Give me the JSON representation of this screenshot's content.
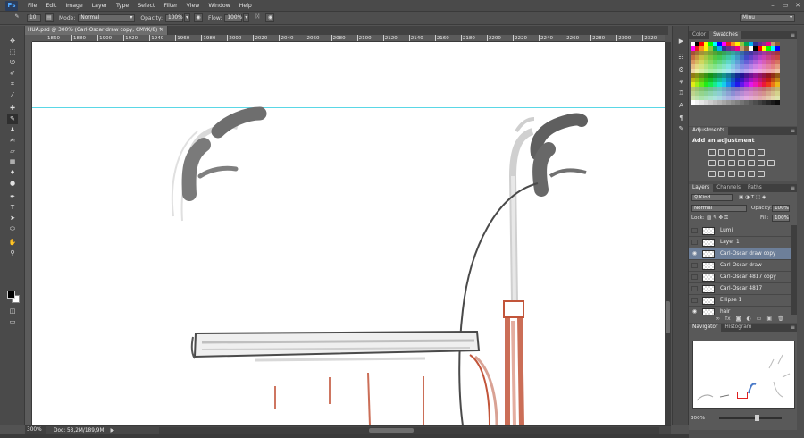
{
  "menubar": {
    "logo": "Ps",
    "items": [
      "File",
      "Edit",
      "Image",
      "Layer",
      "Type",
      "Select",
      "Filter",
      "View",
      "Window",
      "Help"
    ],
    "window_controls": [
      "–",
      "▭",
      "✕"
    ]
  },
  "options": {
    "brush_size": "10",
    "mode_label": "Mode:",
    "mode_value": "Normal",
    "opacity_label": "Opacity:",
    "opacity_value": "100%",
    "flow_label": "Flow:",
    "flow_value": "100%",
    "workspace": "Minu"
  },
  "document": {
    "tab_title": "HUA.psd @ 300% (Carl-Oscar draw copy, CMYK/8) *",
    "tab_close": "×"
  },
  "ruler": {
    "labels": [
      "1860",
      "1880",
      "1900",
      "1920",
      "1940",
      "1960",
      "1980",
      "2000",
      "2020",
      "2040",
      "2060",
      "2080",
      "2100",
      "2120",
      "2140",
      "2160",
      "2180",
      "2200",
      "2220",
      "2240",
      "2260",
      "2280",
      "2300",
      "2320",
      "2340"
    ]
  },
  "status": {
    "zoom": "300%",
    "doc_size": "Doc: 53,2M/189,9M",
    "arrow": "▶"
  },
  "panels": {
    "color_tab": "Color",
    "swatches_tab": "Swatches",
    "adjustments_tab": "Adjustments",
    "adjustments_title": "Add an adjustment",
    "layers_tab": "Layers",
    "channels_tab": "Channels",
    "paths_tab": "Paths",
    "kind_label": "Kind",
    "blend_mode": "Normal",
    "opacity_label": "Opacity:",
    "opacity_value": "100%",
    "lock_label": "Lock:",
    "fill_label": "Fill:",
    "fill_value": "100%",
    "layers": [
      {
        "name": "Lumi",
        "visible": false,
        "selected": false
      },
      {
        "name": "Layer 1",
        "visible": false,
        "selected": false
      },
      {
        "name": "Carl-Oscar draw copy",
        "visible": true,
        "selected": true
      },
      {
        "name": "Carl-Oscar draw",
        "visible": false,
        "selected": false
      },
      {
        "name": "Carl-Oscar 4817 copy",
        "visible": false,
        "selected": false
      },
      {
        "name": "Carl-Oscar 4817",
        "visible": false,
        "selected": false
      },
      {
        "name": "Ellipse 1",
        "visible": false,
        "selected": false
      },
      {
        "name": "hair",
        "visible": true,
        "selected": false
      }
    ],
    "navigator_tab": "Navigator",
    "histogram_tab": "Histogram",
    "navigator_zoom": "300%"
  },
  "colors": {
    "accent_selection": "#6d7f99",
    "guide": "#5ad7e6",
    "brush_red": "#c2553a"
  }
}
